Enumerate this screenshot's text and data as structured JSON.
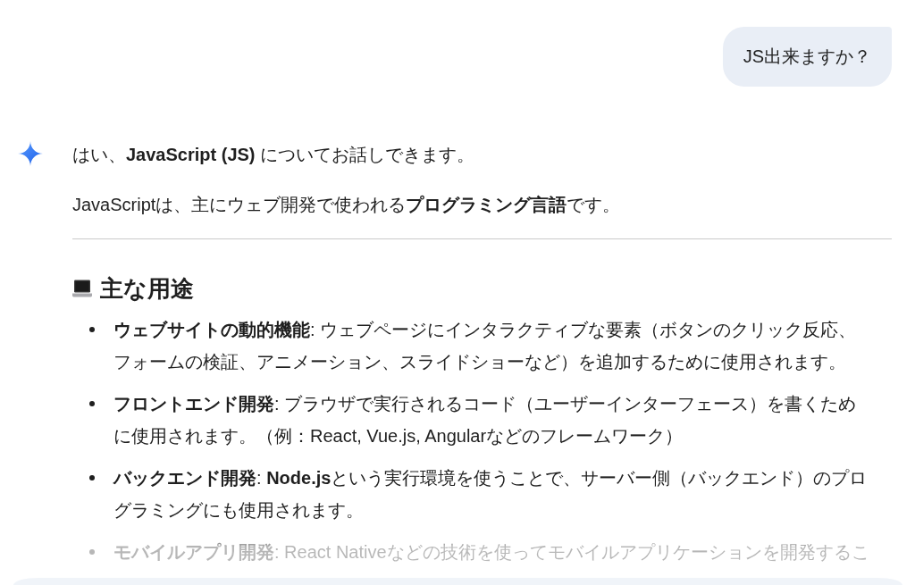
{
  "user_message": {
    "text": "JS出来ますか？"
  },
  "response": {
    "blocks": [
      {
        "kind": "paragraph",
        "text": "はい、**JavaScript (JS)** についてお話しできます。"
      },
      {
        "kind": "paragraph",
        "text": "JavaScriptは、主にウェブ開発で使われる**プログラミング言語**です。"
      },
      {
        "kind": "divider"
      },
      {
        "kind": "heading",
        "text": "主な用途"
      },
      {
        "kind": "list",
        "items": [
          "**ウェブサイトの動的機能**: ウェブページにインタラクティブな要素（ボタンのクリック反応、フォームの検証、アニメーション、スライドショーなど）を追加するために使用されます。",
          "**フロントエンド開発**: ブラウザで実行されるコード（ユーザーインターフェース）を書くために使用されます。（例：React, Vue.js, Angularなどのフレームワーク）",
          "**バックエンド開発**: **Node.js**という実行環境を使うことで、サーバー側（バックエンド）のプログラミングにも使用されます。",
          "**モバイルアプリ開発**: React Nativeなどの技術を使ってモバイルアプリケーションを開発するこ"
        ]
      }
    ]
  }
}
